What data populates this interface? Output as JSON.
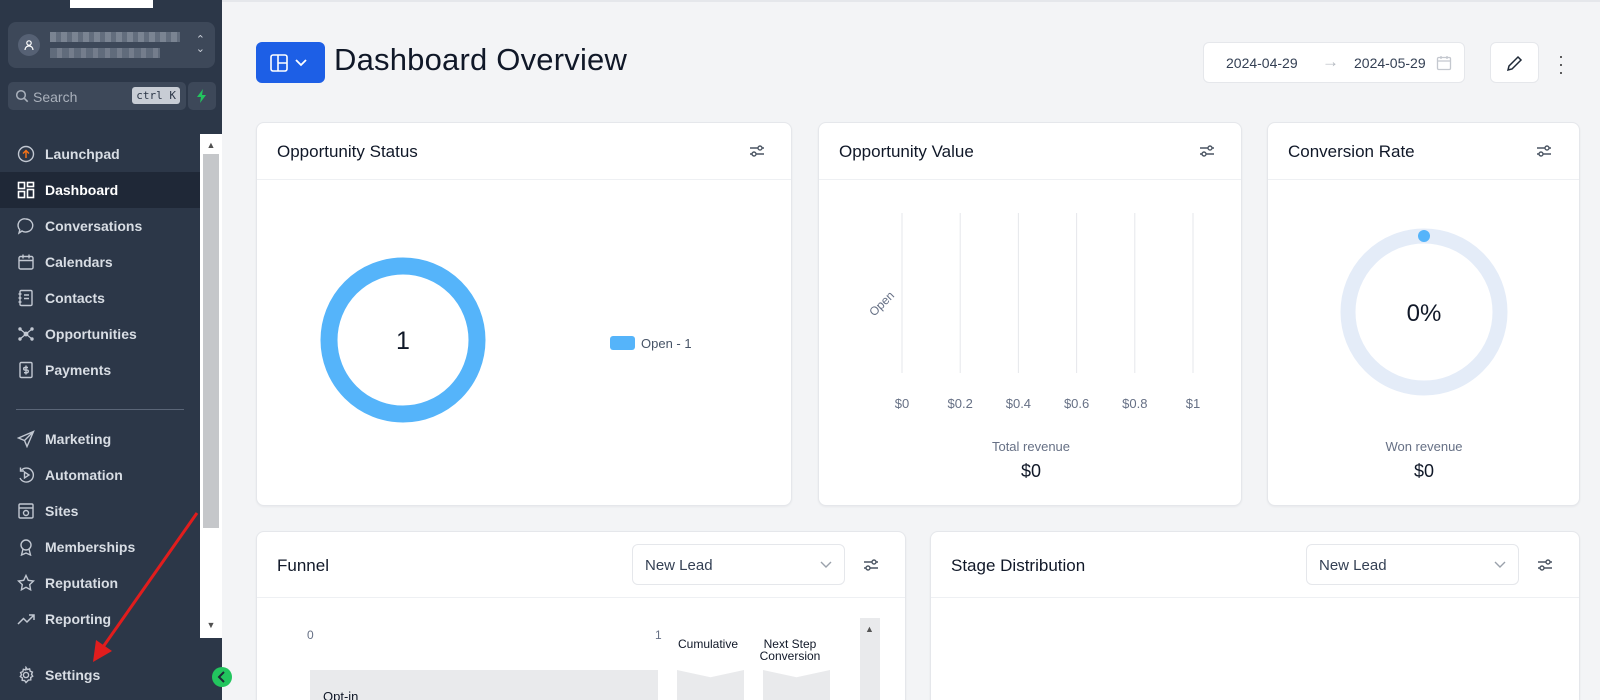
{
  "app": {
    "search": {
      "placeholder": "Search",
      "shortcut": "ctrl K"
    }
  },
  "sidebar": {
    "items": [
      {
        "label": "Launchpad",
        "icon": "launchpad-icon"
      },
      {
        "label": "Dashboard",
        "icon": "dashboard-grid-icon",
        "active": true
      },
      {
        "label": "Conversations",
        "icon": "chat-bubble-icon"
      },
      {
        "label": "Calendars",
        "icon": "calendar-icon"
      },
      {
        "label": "Contacts",
        "icon": "contacts-book-icon"
      },
      {
        "label": "Opportunities",
        "icon": "opportunities-nodes-icon"
      },
      {
        "label": "Payments",
        "icon": "payments-icon"
      },
      {
        "label": "Marketing",
        "icon": "send-plane-icon"
      },
      {
        "label": "Automation",
        "icon": "automation-icon"
      },
      {
        "label": "Sites",
        "icon": "sites-browser-icon"
      },
      {
        "label": "Memberships",
        "icon": "award-ribbon-icon"
      },
      {
        "label": "Reputation",
        "icon": "star-icon"
      },
      {
        "label": "Reporting",
        "icon": "trend-up-icon"
      },
      {
        "label": "Settings",
        "icon": "gear-icon"
      }
    ]
  },
  "header": {
    "title": "Dashboard Overview",
    "date_start": "2024-04-29",
    "date_end": "2024-05-29",
    "accent": "#1d5fe6"
  },
  "cards": {
    "opportunity_status": {
      "title": "Opportunity Status"
    },
    "opportunity_value": {
      "title": "Opportunity Value",
      "summary_label": "Total revenue",
      "summary_value": "$0"
    },
    "conversion_rate": {
      "title": "Conversion Rate",
      "summary_label": "Won revenue",
      "summary_value": "$0"
    },
    "funnel": {
      "title": "Funnel",
      "select_value": "New Lead",
      "axis_min": "0",
      "axis_max": "1",
      "col_cumulative": "Cumulative",
      "col_next_step_line1": "Next Step",
      "col_next_step_line2": "Conversion",
      "stage": "Opt-in"
    },
    "stage_distribution": {
      "title": "Stage Distribution",
      "select_value": "New Lead"
    }
  },
  "chart_data": [
    {
      "type": "pie",
      "title": "Opportunity Status",
      "center_label": "1",
      "categories": [
        "Open - 1"
      ],
      "values": [
        1
      ],
      "colors": [
        "#55b4fa"
      ],
      "legend": "right"
    },
    {
      "type": "bar",
      "title": "Opportunity Value",
      "orientation": "horizontal",
      "categories": [
        "Open"
      ],
      "values": [
        0
      ],
      "x_ticks": [
        "$0",
        "$0.2",
        "$0.4",
        "$0.6",
        "$0.8",
        "$1"
      ],
      "xlim": [
        0,
        1
      ],
      "grid": true
    },
    {
      "type": "pie",
      "title": "Conversion Rate",
      "center_label": "0%",
      "values": [
        0
      ],
      "colors": [
        "#55b4fa",
        "#e4ecf8"
      ]
    }
  ]
}
